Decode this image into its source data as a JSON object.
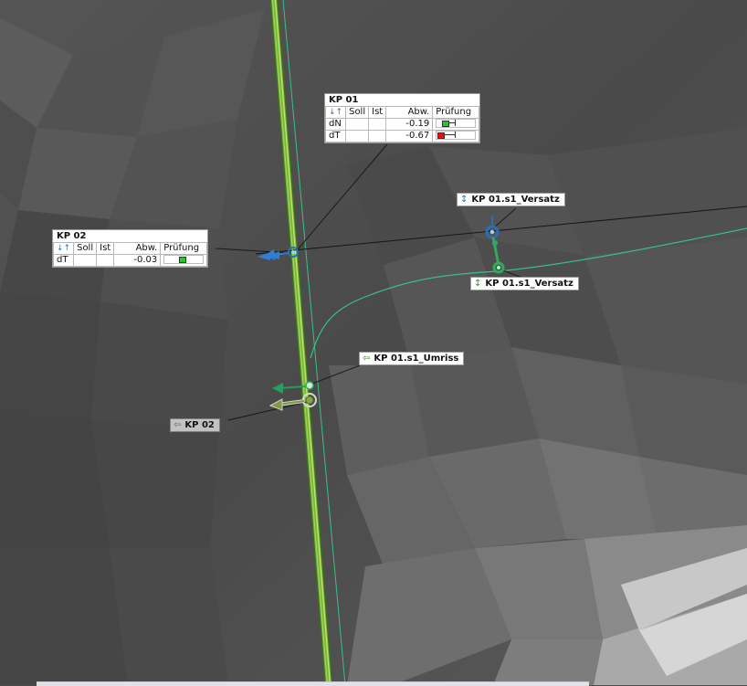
{
  "colors": {
    "background": "#4c4c4c",
    "tunnel_axis": "#6fa83a",
    "blue_marker": "#2f6db3",
    "green_marker": "#2faa5f",
    "profile_line": "#3bbf83",
    "status_ok": "#22cc22",
    "status_fail": "#dd1111"
  },
  "headers": {
    "soll": "Soll",
    "ist": "Ist",
    "abw": "Abw.",
    "pruefung": "Prüfung"
  },
  "kp01_table": {
    "title": "KP 01",
    "rows": [
      {
        "name": "dN",
        "soll": "",
        "ist": "",
        "abw": "-0.19",
        "status": "ok",
        "deviation": -0.19
      },
      {
        "name": "dT",
        "soll": "",
        "ist": "",
        "abw": "-0.67",
        "status": "fail",
        "deviation": -0.67
      }
    ]
  },
  "kp02_table": {
    "title": "KP 02",
    "rows": [
      {
        "name": "dT",
        "soll": "",
        "ist": "",
        "abw": "-0.03",
        "status": "ok",
        "deviation": -0.03
      }
    ]
  },
  "labels": {
    "versatz_blue": {
      "text": "KP 01.s1_Versatz",
      "icon": "vertical-arrow-icon"
    },
    "versatz_green": {
      "text": "KP 01.s1_Versatz",
      "icon": "vertical-arrow-icon"
    },
    "umriss": {
      "text": "KP 01.s1_Umriss",
      "icon": "profile-enter-icon"
    },
    "kp02": {
      "text": "KP 02",
      "icon": "profile-enter-icon"
    }
  }
}
